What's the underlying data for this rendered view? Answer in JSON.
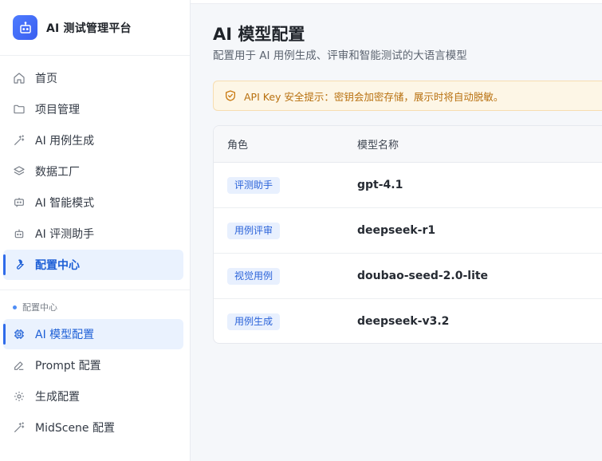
{
  "brand": {
    "title": "AI 测试管理平台",
    "logo_icon": "robot-icon",
    "accent": "#3a5ef0"
  },
  "sidebar": {
    "items": [
      {
        "label": "首页",
        "icon": "home-icon"
      },
      {
        "label": "项目管理",
        "icon": "folder-icon"
      },
      {
        "label": "AI 用例生成",
        "icon": "magic-wand-icon"
      },
      {
        "label": "数据工厂",
        "icon": "layers-icon"
      },
      {
        "label": "AI 智能模式",
        "icon": "chat-bot-icon"
      },
      {
        "label": "AI 评测助手",
        "icon": "robot-icon"
      },
      {
        "label": "配置中心",
        "icon": "wrench-icon",
        "active": true
      }
    ],
    "section_label": "配置中心",
    "sub_items": [
      {
        "label": "AI 模型配置",
        "icon": "chip-icon",
        "active": true
      },
      {
        "label": "Prompt 配置",
        "icon": "edit-icon"
      },
      {
        "label": "生成配置",
        "icon": "gear-icon"
      },
      {
        "label": "MidScene 配置",
        "icon": "magic-wand-icon"
      }
    ]
  },
  "main": {
    "title": "AI 模型配置",
    "subtitle": "配置用于 AI 用例生成、评审和智能测试的大语言模型",
    "alert": {
      "text": "API Key 安全提示：密钥会加密存储，展示时将自动脱敏。",
      "icon": "shield-check-icon"
    },
    "table": {
      "columns": [
        "角色",
        "模型名称"
      ],
      "rows": [
        {
          "role": "评测助手",
          "model": "gpt-4.1"
        },
        {
          "role": "用例评审",
          "model": "deepseek-r1"
        },
        {
          "role": "视觉用例",
          "model": "doubao-seed-2.0-lite"
        },
        {
          "role": "用例生成",
          "model": "deepseek-v3.2"
        }
      ]
    }
  },
  "colors": {
    "active_bg": "#eaf2fe",
    "active_text": "#1d5fd6",
    "alert_bg": "#fdf6e6",
    "alert_text": "#b8700f",
    "tag_bg": "#e8f0fe",
    "tag_text": "#2b63d9"
  }
}
